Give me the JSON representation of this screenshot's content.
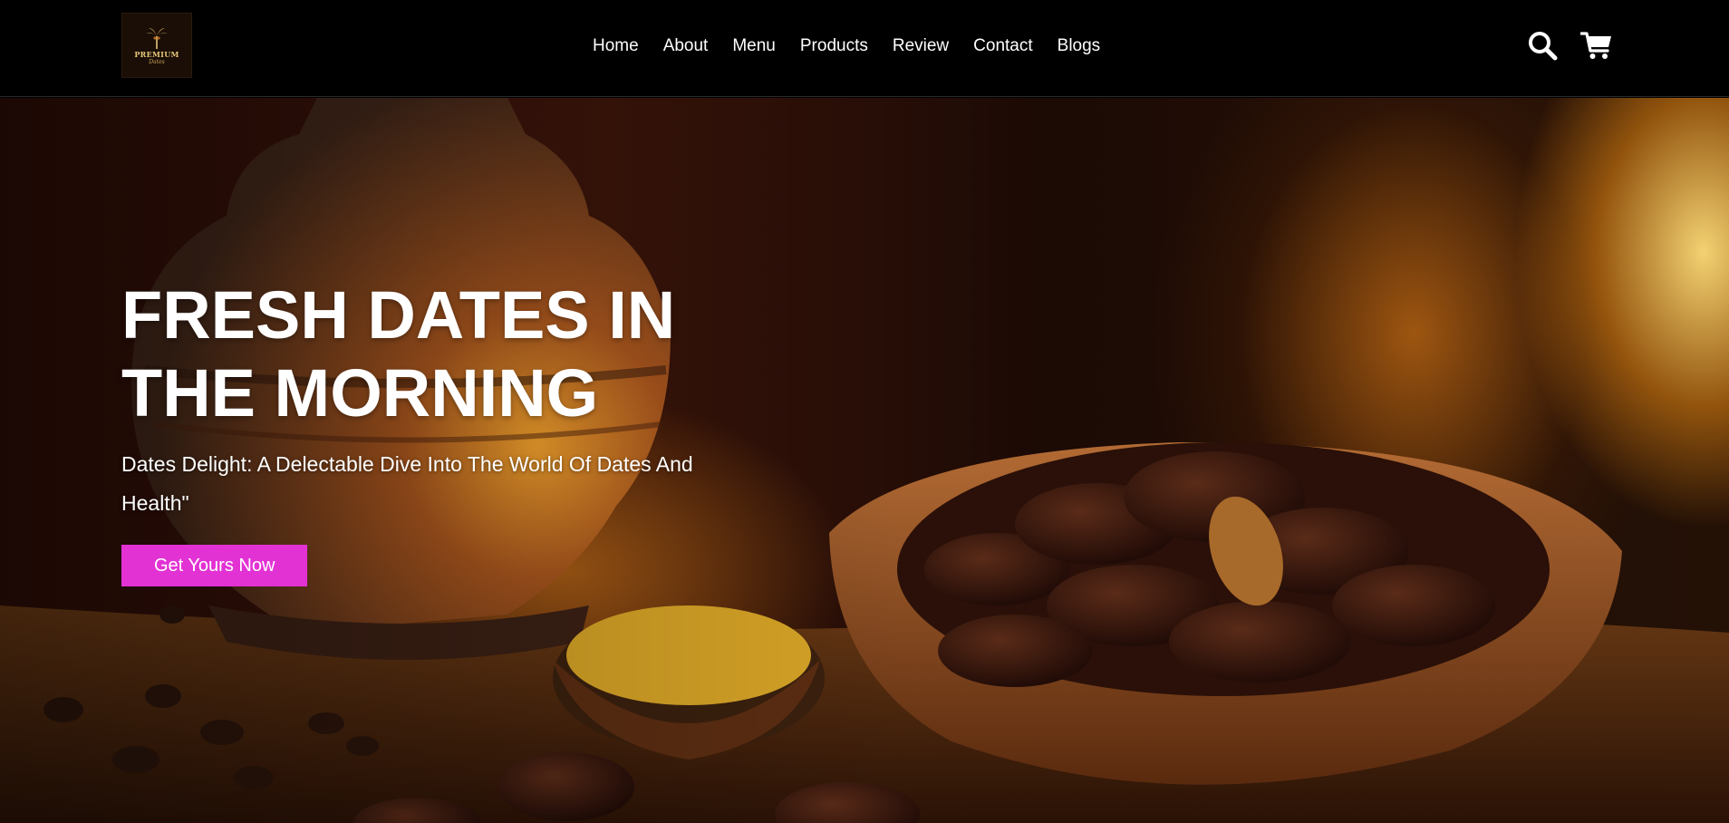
{
  "brand": {
    "logo_text": "PREMIUM",
    "logo_sub": "Dates",
    "logo_icon": "palm-tree-icon"
  },
  "nav": {
    "items": [
      {
        "label": "Home"
      },
      {
        "label": "About"
      },
      {
        "label": "Menu"
      },
      {
        "label": "Products"
      },
      {
        "label": "Review"
      },
      {
        "label": "Contact"
      },
      {
        "label": "Blogs"
      }
    ]
  },
  "header_icons": [
    "search-icon",
    "cart-icon"
  ],
  "hero": {
    "title": "FRESH DATES IN THE MORNING",
    "subtitle": "Dates Delight: A Delectable Dive Into The World Of Dates And Health\"",
    "cta_label": "Get Yours Now"
  },
  "colors": {
    "header_bg": "#000000",
    "accent": "#e232d4",
    "text": "#ffffff"
  }
}
